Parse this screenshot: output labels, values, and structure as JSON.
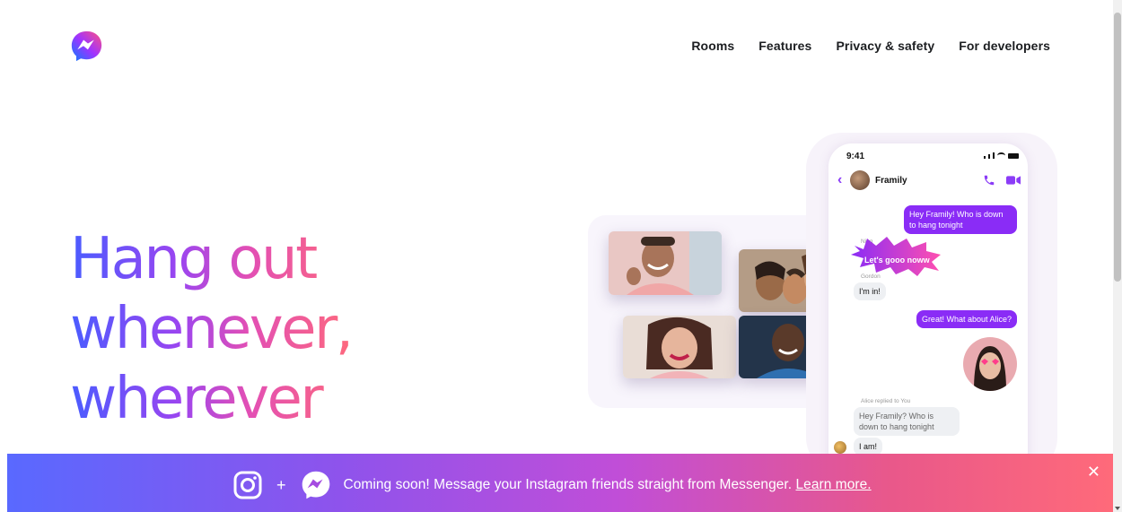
{
  "brand": {
    "logo": "messenger-logo",
    "accent": "#0a7cff"
  },
  "nav": {
    "items": [
      {
        "label": "Rooms"
      },
      {
        "label": "Features"
      },
      {
        "label": "Privacy & safety"
      },
      {
        "label": "For developers"
      }
    ]
  },
  "hero": {
    "headline_lines": [
      "Hang out",
      "whenever,",
      "wherever"
    ]
  },
  "phone": {
    "status_time": "9:41",
    "chat_title": "Framily",
    "messages": [
      {
        "from": "me",
        "text": "Hey Framily! Who is down to hang tonight"
      },
      {
        "sender": "Ning",
        "text": "Let's gooo noww"
      },
      {
        "sender": "Gordon",
        "text": "I'm in!"
      },
      {
        "from": "me",
        "text": "Great! What about Alice?"
      },
      {
        "reply_note": "Alice replied to You",
        "quoted": "Hey Framily? Who is down to hang tonight"
      },
      {
        "text": "I am!"
      }
    ]
  },
  "banner": {
    "text": "Coming soon! Message your Instagram friends straight from Messenger.",
    "link": "Learn more.",
    "plus": "+",
    "close": "✕",
    "icons": [
      "instagram-icon",
      "messenger-icon"
    ]
  }
}
